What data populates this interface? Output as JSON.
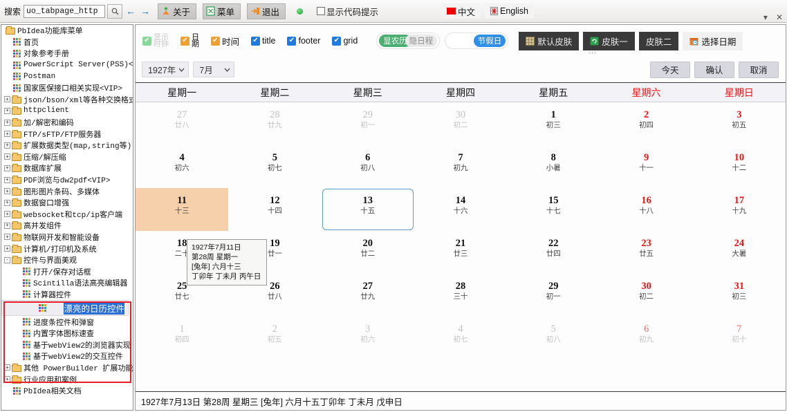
{
  "toolbar": {
    "search_label": "搜索",
    "search_value": "uo_tabpage_http",
    "search_placeholder": "",
    "search_icon": "search-icon",
    "prev_icon": "←",
    "next_icon": "→",
    "about_label": "关于",
    "menu_label": "菜单",
    "exit_label": "退出",
    "show_code_hint_label": "显示代码提示",
    "lang_cn_label": "中文",
    "lang_en_label": "English",
    "minimize_glyph": "▾",
    "close_glyph": "✕"
  },
  "tree": {
    "root": "PbIdea功能库菜单",
    "items": [
      {
        "label": "首页",
        "type": "leaf",
        "depth": 1
      },
      {
        "label": "对象参考手册",
        "type": "leaf",
        "depth": 1
      },
      {
        "label": "PowerScript Server(PSS)<VIP>",
        "type": "leaf",
        "depth": 1
      },
      {
        "label": "Postman",
        "type": "leaf",
        "depth": 1
      },
      {
        "label": "国家医保接口相关实现<VIP>",
        "type": "leaf",
        "depth": 1
      },
      {
        "label": "json/bson/xml等各种交换格式",
        "type": "folder",
        "depth": 1,
        "expander": "+"
      },
      {
        "label": "httpclient",
        "type": "folder",
        "depth": 1,
        "expander": "+"
      },
      {
        "label": "加/解密和编码",
        "type": "folder",
        "depth": 1,
        "expander": "+"
      },
      {
        "label": "FTP/sFTP/FTP服务器",
        "type": "folder",
        "depth": 1,
        "expander": "+"
      },
      {
        "label": "扩展数据类型(map,string等)",
        "type": "folder",
        "depth": 1,
        "expander": "+"
      },
      {
        "label": "压缩/解压缩",
        "type": "folder",
        "depth": 1,
        "expander": "+"
      },
      {
        "label": "数据库扩展",
        "type": "folder",
        "depth": 1,
        "expander": "+"
      },
      {
        "label": "PDF浏览与dw2pdf<VIP>",
        "type": "folder",
        "depth": 1,
        "expander": "+"
      },
      {
        "label": "图形图片条码、多媒体",
        "type": "folder",
        "depth": 1,
        "expander": "+"
      },
      {
        "label": "数据窗口增强",
        "type": "folder",
        "depth": 1,
        "expander": "+"
      },
      {
        "label": "websocket和tcp/ip客户端",
        "type": "folder",
        "depth": 1,
        "expander": "+"
      },
      {
        "label": "高并发组件",
        "type": "folder",
        "depth": 1,
        "expander": "+"
      },
      {
        "label": "物联网开发和智能设备",
        "type": "folder",
        "depth": 1,
        "expander": "+"
      },
      {
        "label": "计算机/打印机及系统",
        "type": "folder",
        "depth": 1,
        "expander": "+"
      },
      {
        "label": "控件与界面美观",
        "type": "folder",
        "depth": 1,
        "expander": "-"
      },
      {
        "label": "打开/保存对话框",
        "type": "leaf",
        "depth": 2
      },
      {
        "label": "Scintilla语法高亮编辑器",
        "type": "leaf",
        "depth": 2
      },
      {
        "label": "计算器控件",
        "type": "leaf",
        "depth": 2
      },
      {
        "label": "漂亮的日历控件",
        "type": "leaf",
        "depth": 2,
        "selected": true
      },
      {
        "label": "进度条控件和弹窗",
        "type": "leaf",
        "depth": 2
      },
      {
        "label": "内置字体图标速查",
        "type": "leaf",
        "depth": 2
      },
      {
        "label": "基于webView2的浏览器实现",
        "type": "leaf",
        "depth": 2
      },
      {
        "label": "基于webView2的交互控件",
        "type": "leaf",
        "depth": 2
      },
      {
        "label": "其他 PowerBuilder 扩展功能",
        "type": "folder",
        "depth": 1,
        "expander": "+"
      },
      {
        "label": "行业应用和案例",
        "type": "folder",
        "depth": 1,
        "expander": "+"
      },
      {
        "label": "PbIdea相关文档",
        "type": "leaf",
        "depth": 1
      }
    ]
  },
  "controls": {
    "checkboxes": [
      {
        "label": "显示时钟",
        "checked": true,
        "disabled": true,
        "color": "green",
        "stacked": true
      },
      {
        "label": "日期",
        "checked": true,
        "disabled": false,
        "color": "orange",
        "stacked": true
      },
      {
        "label": "时间",
        "checked": true,
        "disabled": false,
        "color": "orange",
        "stacked": false
      },
      {
        "label": "title",
        "checked": true,
        "disabled": false,
        "color": "blue",
        "stacked": false
      },
      {
        "label": "footer",
        "checked": true,
        "disabled": false,
        "color": "blue",
        "stacked": false
      },
      {
        "label": "grid",
        "checked": true,
        "disabled": false,
        "color": "blue",
        "stacked": false
      }
    ],
    "switches": [
      {
        "on_label": "显农历",
        "off_label": "隐日程",
        "state": "left",
        "knob_color": "#4caf72"
      },
      {
        "on_label": "节假日",
        "state": "right",
        "knob_color": "#2e8fe8"
      }
    ],
    "skin_buttons": [
      {
        "label": "默认皮肤",
        "icon": "grid-icon",
        "style": "dark"
      },
      {
        "label": "皮肤一",
        "icon": "refresh-icon",
        "style": "dark"
      },
      {
        "label": "皮肤二",
        "icon": "",
        "style": "dark"
      },
      {
        "label": "选择日期",
        "icon": "calendar-icon",
        "style": "light"
      }
    ],
    "overflow_dots": "⋯"
  },
  "selectors": {
    "year": "1927年",
    "month": "7月",
    "chevron": "⌄",
    "today_label": "今天",
    "confirm_label": "确认",
    "cancel_label": "取消"
  },
  "calendar": {
    "weekdays": [
      {
        "label": "星期一",
        "weekend": false
      },
      {
        "label": "星期二",
        "weekend": false
      },
      {
        "label": "星期三",
        "weekend": false
      },
      {
        "label": "星期四",
        "weekend": false
      },
      {
        "label": "星期五",
        "weekend": false
      },
      {
        "label": "星期六",
        "weekend": true
      },
      {
        "label": "星期日",
        "weekend": true
      }
    ],
    "days": [
      {
        "d": "27",
        "l": "廿八",
        "out": true,
        "red": false
      },
      {
        "d": "28",
        "l": "廿九",
        "out": true,
        "red": false
      },
      {
        "d": "29",
        "l": "初一",
        "out": true,
        "red": false
      },
      {
        "d": "30",
        "l": "初二",
        "out": true,
        "red": false
      },
      {
        "d": "1",
        "l": "初三",
        "out": false,
        "red": false
      },
      {
        "d": "2",
        "l": "初四",
        "out": false,
        "red": true
      },
      {
        "d": "3",
        "l": "初五",
        "out": false,
        "red": true
      },
      {
        "d": "4",
        "l": "初六",
        "out": false,
        "red": false
      },
      {
        "d": "5",
        "l": "初七",
        "out": false,
        "red": false
      },
      {
        "d": "6",
        "l": "初八",
        "out": false,
        "red": false
      },
      {
        "d": "7",
        "l": "初九",
        "out": false,
        "red": false
      },
      {
        "d": "8",
        "l": "小暑",
        "out": false,
        "red": false
      },
      {
        "d": "9",
        "l": "十一",
        "out": false,
        "red": true
      },
      {
        "d": "10",
        "l": "十二",
        "out": false,
        "red": true
      },
      {
        "d": "11",
        "l": "十三",
        "out": false,
        "red": false,
        "selected": true
      },
      {
        "d": "12",
        "l": "十四",
        "out": false,
        "red": false
      },
      {
        "d": "13",
        "l": "十五",
        "out": false,
        "red": false,
        "boxed": true
      },
      {
        "d": "14",
        "l": "十六",
        "out": false,
        "red": false
      },
      {
        "d": "15",
        "l": "十七",
        "out": false,
        "red": false
      },
      {
        "d": "16",
        "l": "十八",
        "out": false,
        "red": true
      },
      {
        "d": "17",
        "l": "十九",
        "out": false,
        "red": true
      },
      {
        "d": "18",
        "l": "二十",
        "out": false,
        "red": false
      },
      {
        "d": "19",
        "l": "廿一",
        "out": false,
        "red": false
      },
      {
        "d": "20",
        "l": "廿二",
        "out": false,
        "red": false
      },
      {
        "d": "21",
        "l": "廿三",
        "out": false,
        "red": false
      },
      {
        "d": "22",
        "l": "廿四",
        "out": false,
        "red": false
      },
      {
        "d": "23",
        "l": "廿五",
        "out": false,
        "red": true
      },
      {
        "d": "24",
        "l": "大暑",
        "out": false,
        "red": true
      },
      {
        "d": "25",
        "l": "廿七",
        "out": false,
        "red": false
      },
      {
        "d": "26",
        "l": "廿八",
        "out": false,
        "red": false
      },
      {
        "d": "27",
        "l": "廿九",
        "out": false,
        "red": false
      },
      {
        "d": "28",
        "l": "三十",
        "out": false,
        "red": false
      },
      {
        "d": "29",
        "l": "初一",
        "out": false,
        "red": false
      },
      {
        "d": "30",
        "l": "初二",
        "out": false,
        "red": true
      },
      {
        "d": "31",
        "l": "初三",
        "out": false,
        "red": true
      },
      {
        "d": "1",
        "l": "初四",
        "out": true,
        "red": false
      },
      {
        "d": "2",
        "l": "初五",
        "out": true,
        "red": false
      },
      {
        "d": "3",
        "l": "初六",
        "out": true,
        "red": false
      },
      {
        "d": "4",
        "l": "初七",
        "out": true,
        "red": false
      },
      {
        "d": "5",
        "l": "初八",
        "out": true,
        "red": false
      },
      {
        "d": "6",
        "l": "初九",
        "out": true,
        "red": true
      },
      {
        "d": "7",
        "l": "初十",
        "out": true,
        "red": true
      }
    ]
  },
  "tooltip": {
    "line1": "1927年7月11日",
    "line2": "第28周 星期一",
    "line3": "[兔年] 六月十三",
    "line4": "丁卯年 丁未月 丙午日"
  },
  "footer": {
    "text": "1927年7月13日 第28周 星期三 [兔年] 六月十五丁卯年 丁未月 戊申日"
  },
  "colors": {
    "selected_day_bg": "#f6cfab",
    "boxed_day_border": "#5b9dc9",
    "weekend_red": "#ee1111",
    "tree_selection": "#2a6fd6",
    "highlight_box": "#ec1c24"
  }
}
